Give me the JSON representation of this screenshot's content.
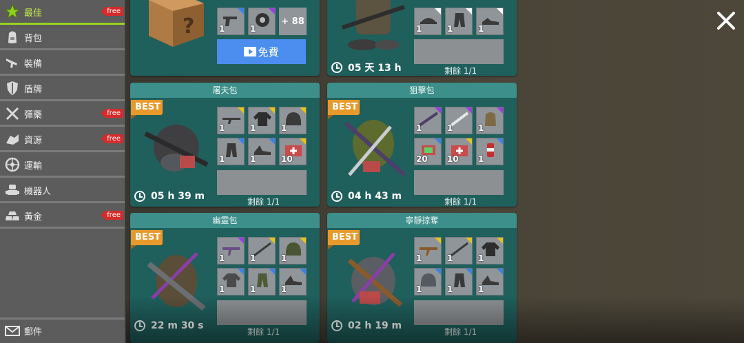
{
  "sidebar": {
    "items": [
      {
        "label": "最佳",
        "icon": "star-icon",
        "free": true
      },
      {
        "label": "背包",
        "icon": "backpack-icon",
        "free": false
      },
      {
        "label": "裝備",
        "icon": "gun-icon",
        "free": false
      },
      {
        "label": "盾牌",
        "icon": "shield-icon",
        "free": false
      },
      {
        "label": "彈藥",
        "icon": "ammo-icon",
        "free": true
      },
      {
        "label": "資源",
        "icon": "resources-icon",
        "free": true
      },
      {
        "label": "運輸",
        "icon": "wheel-icon",
        "free": false
      },
      {
        "label": "機器人",
        "icon": "robot-icon",
        "free": false
      },
      {
        "label": "黃金",
        "icon": "gold-icon",
        "free": true
      }
    ],
    "free_label": "free",
    "mail_label": "郵件"
  },
  "top_left": {
    "plus_label": "+ 88",
    "free_button_label": "免費",
    "slot_qty": [
      "1",
      "1"
    ]
  },
  "top_right": {
    "timer": "05 天 13 h",
    "remaining": "剩餘 1/1",
    "slot_qty": [
      "1",
      "1",
      "1"
    ]
  },
  "packs": [
    {
      "title": "屠夫包",
      "badge": "BEST",
      "timer": "05 h 39 m",
      "remaining": "剩餘 1/1",
      "slots": [
        "1",
        "1",
        "1",
        "1",
        "1",
        "10"
      ]
    },
    {
      "title": "狙擊包",
      "badge": "BEST",
      "timer": "04 h 43 m",
      "remaining": "剩餘 1/1",
      "slots": [
        "1",
        "1",
        "1",
        "20",
        "10",
        "1"
      ]
    },
    {
      "title": "幽靈包",
      "badge": "BEST",
      "timer": "22 m 30 s",
      "remaining": "剩餘 1/1",
      "slots": [
        "1",
        "1",
        "1",
        "1",
        "1",
        "1"
      ]
    },
    {
      "title": "寧靜掠奪",
      "badge": "BEST",
      "timer": "02 h 19 m",
      "remaining": "剩餘 1/1",
      "slots": [
        "1",
        "1",
        "1",
        "1",
        "1",
        "1"
      ]
    }
  ],
  "colors": {
    "accent_green": "#9bd31f",
    "card_bg": "#1f5f5c",
    "card_title": "#3d8f8b",
    "best_badge": "#e79a2b",
    "free_badge": "#d62b2b",
    "free_button": "#4c8df0"
  }
}
